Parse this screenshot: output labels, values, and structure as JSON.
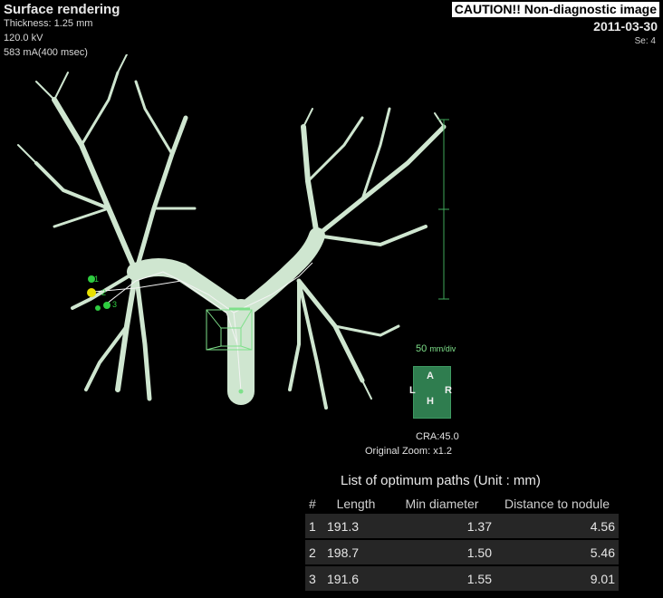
{
  "header": {
    "title": "Surface rendering",
    "thickness": "Thickness: 1.25 mm",
    "voltage": "120.0 kV",
    "current": "583 mA(400 msec)",
    "caution": "CAUTION!! Non-diagnostic image",
    "date": "2011-03-30",
    "series": "Se: 4"
  },
  "scale": {
    "value": "50",
    "unit": "mm/div"
  },
  "orientation": {
    "top": "A",
    "left": "L",
    "right": "R",
    "bottom": "H"
  },
  "view": {
    "cra": "CRA:45.0",
    "zoom": "Original Zoom: x1.2"
  },
  "markers": [
    "1",
    "2",
    "3"
  ],
  "paths_table": {
    "title": "List of optimum paths (Unit : mm)",
    "headers": [
      "#",
      "Length",
      "Min diameter",
      "Distance to nodule"
    ],
    "rows": [
      [
        "1",
        "191.3",
        "1.37",
        "4.56"
      ],
      [
        "2",
        "198.7",
        "1.50",
        "5.46"
      ],
      [
        "3",
        "191.6",
        "1.55",
        "9.01"
      ]
    ]
  },
  "colors": {
    "airway": "#cfe6d0",
    "marker": "#2ecc40",
    "nodule": "#e8e000",
    "accent": "#7ee08a"
  }
}
